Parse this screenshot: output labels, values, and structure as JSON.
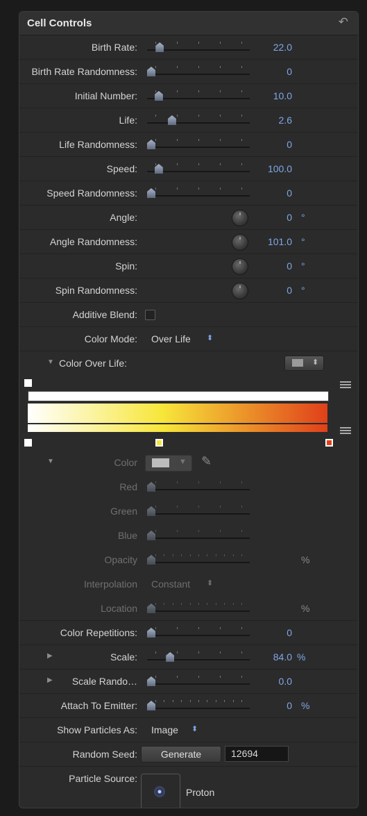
{
  "panel": {
    "title": "Cell Controls",
    "reset_icon": "revert-arrow-icon"
  },
  "rows": {
    "birth_rate": {
      "label": "Birth Rate:",
      "value": "22.0",
      "level": 0.09
    },
    "birth_rate_rand": {
      "label": "Birth Rate Randomness:",
      "value": "0",
      "level": 0.0
    },
    "initial_number": {
      "label": "Initial Number:",
      "value": "10.0",
      "level": 0.08
    },
    "life": {
      "label": "Life:",
      "value": "2.6",
      "level": 0.22
    },
    "life_rand": {
      "label": "Life Randomness:",
      "value": "0",
      "level": 0.0
    },
    "speed": {
      "label": "Speed:",
      "value": "100.0",
      "level": 0.08
    },
    "speed_rand": {
      "label": "Speed Randomness:",
      "value": "0",
      "level": 0.0
    },
    "angle": {
      "label": "Angle:",
      "value": "0",
      "unit": "°"
    },
    "angle_rand": {
      "label": "Angle Randomness:",
      "value": "101.0",
      "unit": "°"
    },
    "spin": {
      "label": "Spin:",
      "value": "0",
      "unit": "°"
    },
    "spin_rand": {
      "label": "Spin Randomness:",
      "value": "0",
      "unit": "°"
    },
    "additive_blend": {
      "label": "Additive Blend:",
      "checked": false
    },
    "color_mode": {
      "label": "Color Mode:",
      "value": "Over Life"
    },
    "color_over_life": {
      "label": "Color Over Life:"
    },
    "color": {
      "label": "Color"
    },
    "red": {
      "label": "Red",
      "level": 0.0
    },
    "green": {
      "label": "Green",
      "level": 0.0
    },
    "blue": {
      "label": "Blue",
      "level": 0.0
    },
    "opacity": {
      "label": "Opacity",
      "unit": "%",
      "level": 0.0
    },
    "interpolation": {
      "label": "Interpolation",
      "value": "Constant"
    },
    "location": {
      "label": "Location",
      "unit": "%",
      "level": 0.0
    },
    "color_repetitions": {
      "label": "Color Repetitions:",
      "value": "0",
      "level": 0.0
    },
    "scale": {
      "label": "Scale:",
      "value": "84.0",
      "unit": "%",
      "level": 0.2
    },
    "scale_rand": {
      "label": "Scale Rando…",
      "value": "0.0",
      "level": 0.0
    },
    "attach_to_emitter": {
      "label": "Attach To Emitter:",
      "value": "0",
      "unit": "%",
      "level": 0.0
    },
    "show_particles_as": {
      "label": "Show Particles As:",
      "value": "Image"
    },
    "random_seed": {
      "label": "Random Seed:",
      "button": "Generate",
      "value": "12694"
    },
    "particle_source": {
      "label": "Particle Source:",
      "value": "Proton"
    }
  },
  "gradient": {
    "top_color": "#ffffff",
    "stops": [
      "#ffffff",
      "#f7e63a",
      "#e0401a"
    ]
  },
  "colors": {
    "accent_value": "#7fa8e8",
    "panel_bg": "#2b2b2b"
  }
}
